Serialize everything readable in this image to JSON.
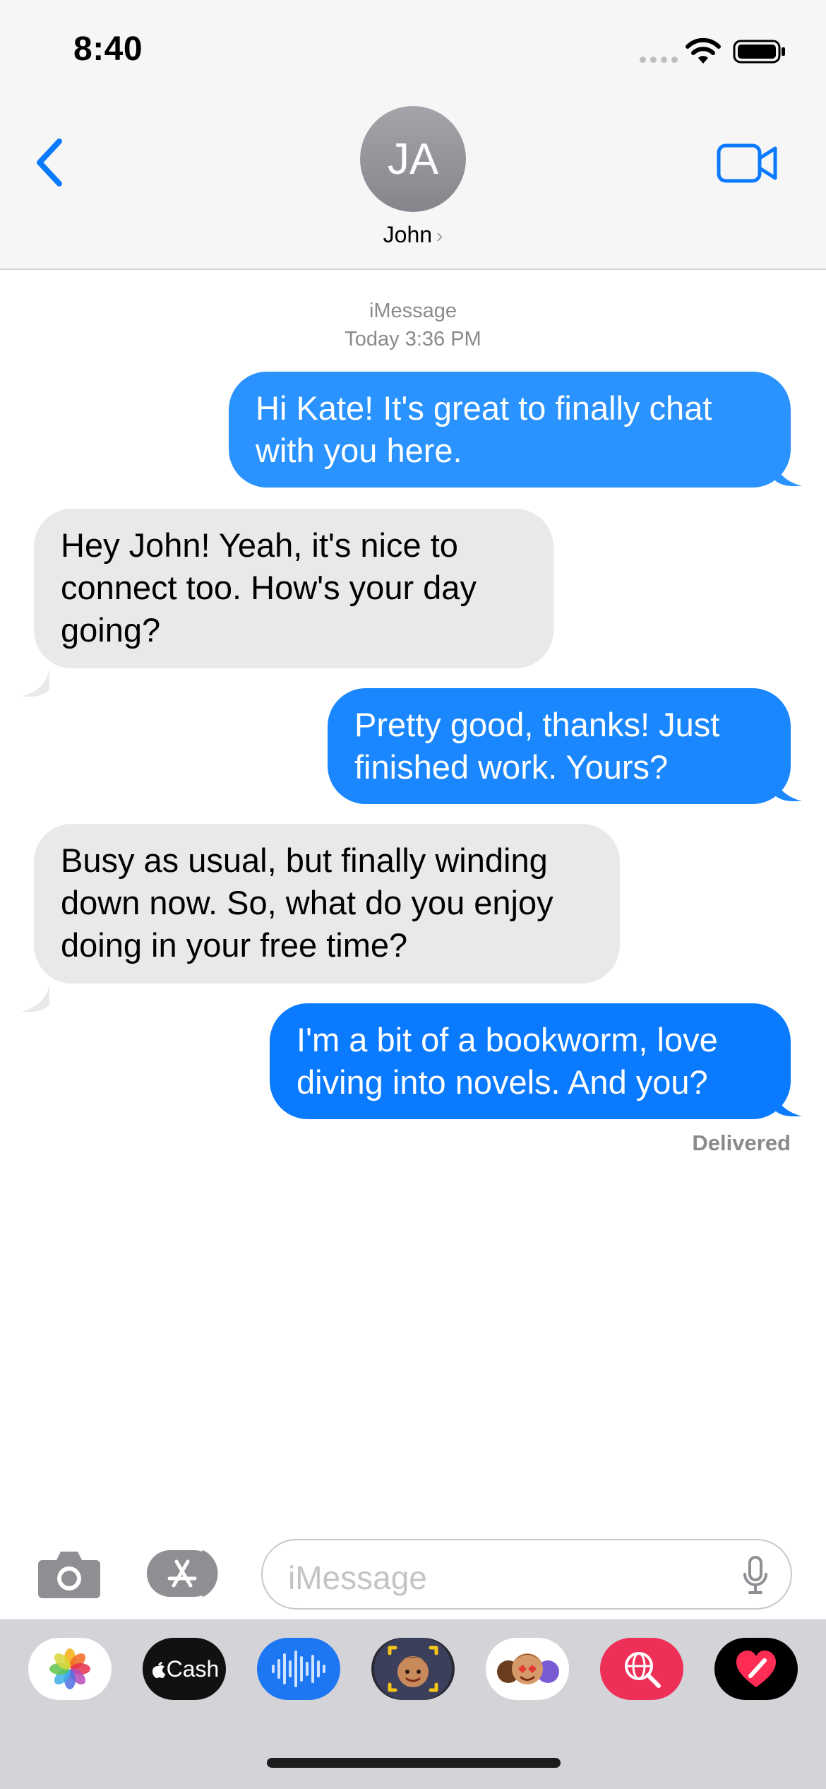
{
  "status": {
    "time": "8:40"
  },
  "header": {
    "avatar_initials": "JA",
    "contact_name": "John"
  },
  "thread": {
    "service": "iMessage",
    "timestamp": "Today 3:36 PM",
    "messages": [
      {
        "from": "me",
        "text": "Hi Kate! It's great to finally chat with you here."
      },
      {
        "from": "them",
        "text": "Hey John! Yeah, it's nice to connect too. How's your day going?"
      },
      {
        "from": "me",
        "text": "Pretty good, thanks! Just finished work. Yours?"
      },
      {
        "from": "them",
        "text": "Busy as usual, but finally winding down now. So, what do you enjoy doing in your free time?"
      },
      {
        "from": "me",
        "text": "I'm a bit of a bookworm, love diving into novels. And you?"
      }
    ],
    "delivery_status": "Delivered"
  },
  "composer": {
    "placeholder": "iMessage"
  },
  "apps": {
    "cash_label": "Cash"
  },
  "colors": {
    "accent": "#0a7aff",
    "bubble_out": "#1a8cff",
    "bubble_in": "#e9e9eb"
  }
}
